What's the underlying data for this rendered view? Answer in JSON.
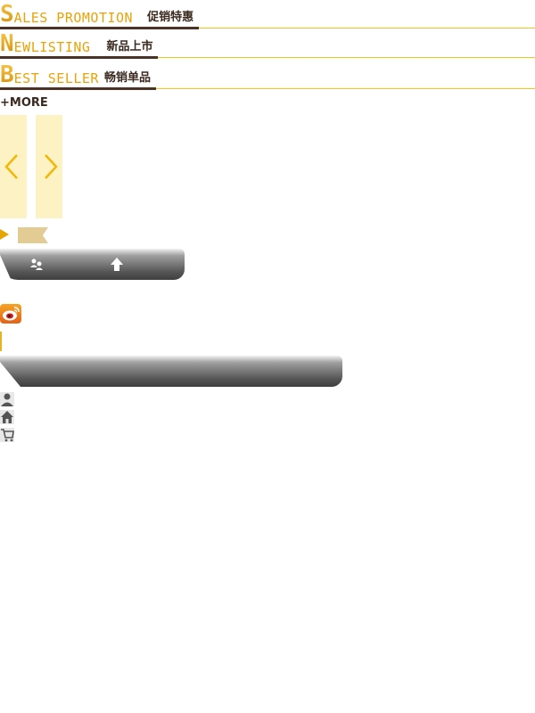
{
  "sections": {
    "sales": {
      "cap": "S",
      "rest": "ALES PROMOTION",
      "cn": "促销特惠"
    },
    "newlisting": {
      "cap": "N",
      "rest": "EWLISTING",
      "cn": "新品上市"
    },
    "bestseller": {
      "cap": "B",
      "rest": "EST SELLER",
      "cn": "畅销单品"
    }
  },
  "more_link": "+MORE",
  "carousel": {
    "prev_icon": "chevron-left-icon",
    "next_icon": "chevron-right-icon"
  },
  "toolbar": {
    "icons": [
      "users-icon",
      "upload-arrow-icon"
    ]
  },
  "side_icons": [
    "person-icon",
    "home-icon",
    "cart-icon"
  ],
  "colors": {
    "accent": "#e6a500",
    "text_dark": "#3b2a1f",
    "arrow_bg": "#fdf2c3",
    "line": "#f0c419"
  }
}
